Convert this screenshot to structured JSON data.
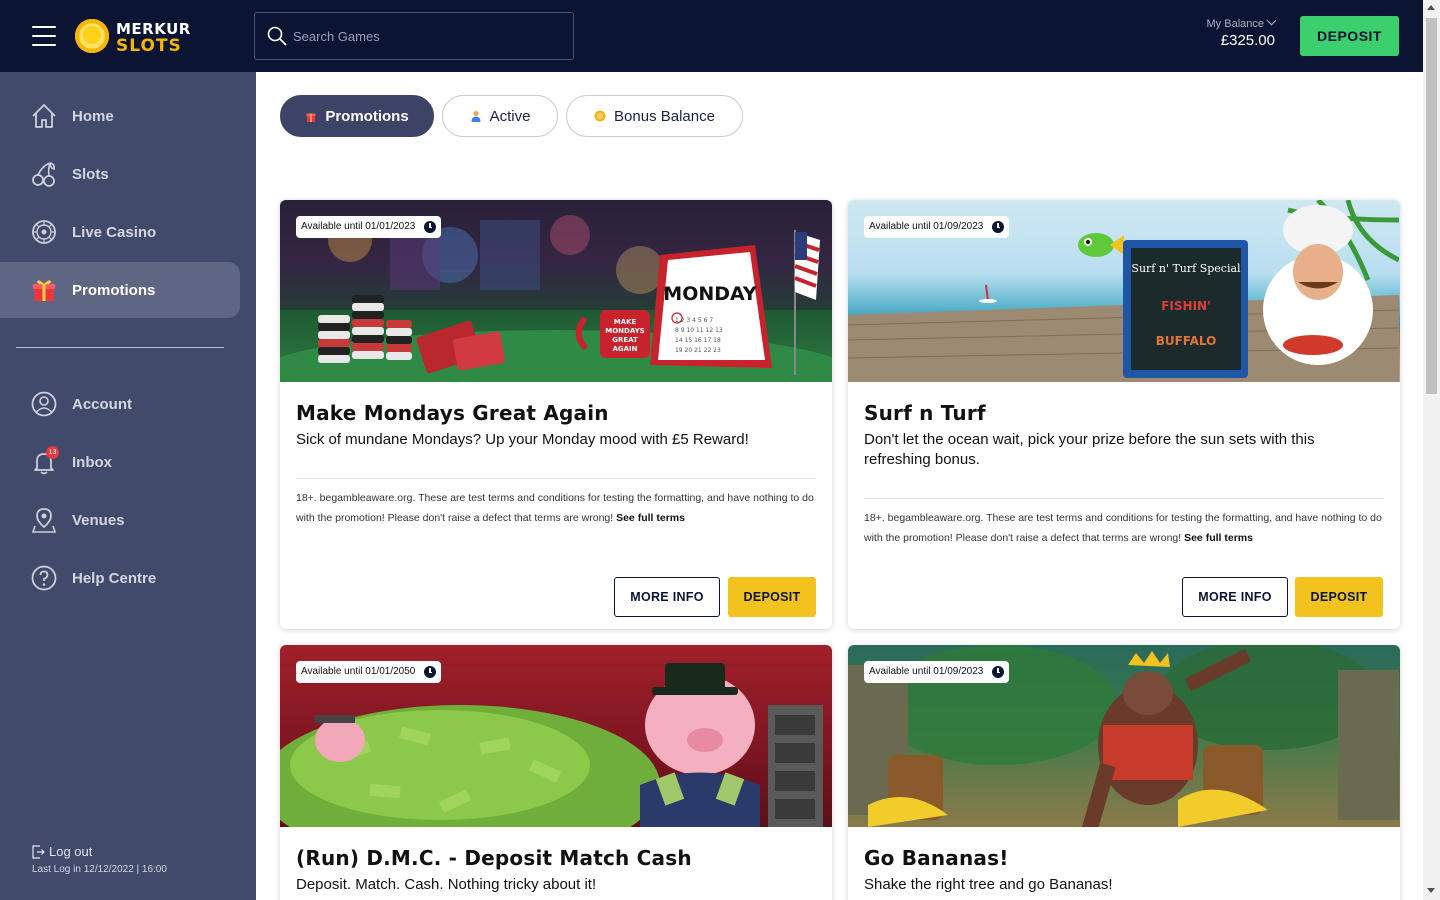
{
  "header": {
    "logo_line1": "MERKUR",
    "logo_line2": "SLOTS",
    "search_placeholder": "Search Games",
    "balance_label": "My Balance",
    "balance_amount": "£325.00",
    "deposit_label": "DEPOSIT"
  },
  "sidebar": {
    "items": [
      {
        "label": "Home",
        "icon": "home-icon"
      },
      {
        "label": "Slots",
        "icon": "cherries-icon"
      },
      {
        "label": "Live Casino",
        "icon": "roulette-icon"
      },
      {
        "label": "Promotions",
        "icon": "gift-icon",
        "active": true
      },
      {
        "label": "Account",
        "icon": "user-icon"
      },
      {
        "label": "Inbox",
        "icon": "bell-icon"
      },
      {
        "label": "Venues",
        "icon": "map-pin-icon"
      },
      {
        "label": "Help Centre",
        "icon": "help-icon"
      }
    ],
    "inbox_badge": "13",
    "logout_label": "Log out",
    "last_login": "Last Log in 12/12/2022 | 16:00"
  },
  "tabs": [
    {
      "label": "Promotions",
      "active": true,
      "icon": "gift-icon"
    },
    {
      "label": "Active",
      "active": false,
      "icon": "person-icon"
    },
    {
      "label": "Bonus Balance",
      "active": false,
      "icon": "coin-icon"
    }
  ],
  "promotions": [
    {
      "available": "Available until 01/01/2023",
      "title": "Make Mondays Great Again",
      "description": "Sick of mundane Mondays? Up your Monday mood with £5 Reward!",
      "terms": "18+. begambleaware.org. These are test terms and conditions for testing the formatting, and have nothing to do with the promotion! Please don't raise a defect that terms are wrong!",
      "terms_link": "See full terms",
      "more_info": "MORE INFO",
      "deposit": "DEPOSIT",
      "banner_text": "MONDAY"
    },
    {
      "available": "Available until 01/09/2023",
      "title": "Surf n Turf",
      "description": "Don't let the ocean wait,  pick your prize before the sun sets with this refreshing bonus.",
      "terms": "18+. begambleaware.org. These are test terms and conditions for testing the formatting, and have nothing to do with the promotion! Please don't raise a defect that terms are wrong!",
      "terms_link": "See full terms",
      "more_info": "MORE INFO",
      "deposit": "DEPOSIT",
      "banner_text": "Surf n' Turf Special"
    },
    {
      "available": "Available until 01/01/2050",
      "title": "(Run) D.M.C. - Deposit Match Cash",
      "description": "Deposit. Match. Cash. Nothing tricky about it!"
    },
    {
      "available": "Available until 01/09/2023",
      "title": "Go Bananas!",
      "description": "Shake the right tree and go Bananas!"
    }
  ],
  "colors": {
    "header_bg": "#0b1533",
    "sidebar_bg": "#414a6b",
    "deposit_green": "#3ccf6e",
    "deposit_yellow": "#f2c21e"
  }
}
